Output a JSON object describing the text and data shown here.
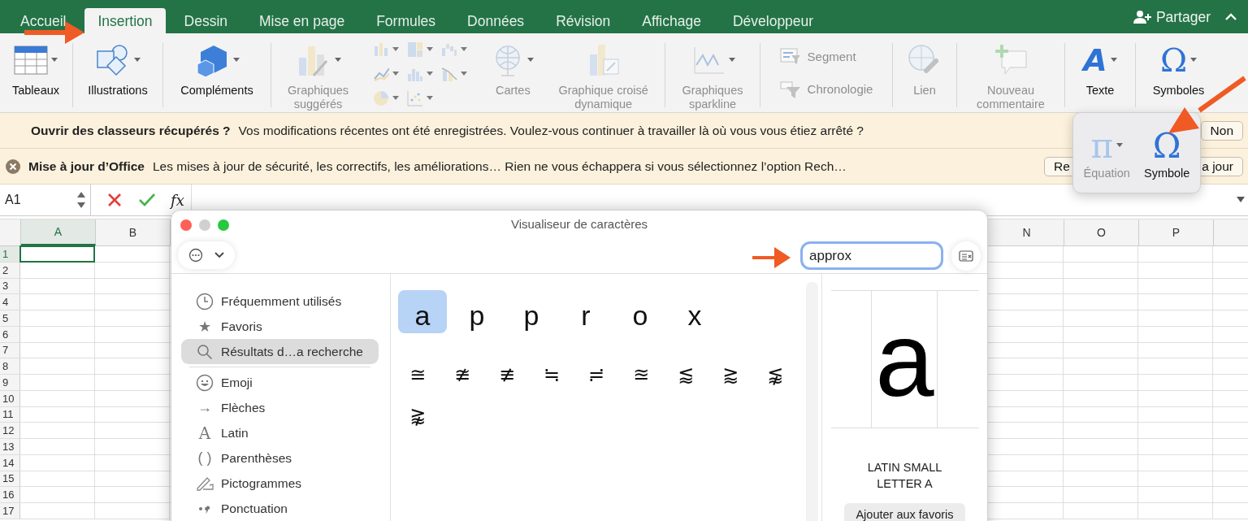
{
  "tabs": [
    {
      "label": "Accueil",
      "selected": false
    },
    {
      "label": "Insertion",
      "selected": true
    },
    {
      "label": "Dessin",
      "selected": false
    },
    {
      "label": "Mise en page",
      "selected": false
    },
    {
      "label": "Formules",
      "selected": false
    },
    {
      "label": "Données",
      "selected": false
    },
    {
      "label": "Révision",
      "selected": false
    },
    {
      "label": "Affichage",
      "selected": false
    },
    {
      "label": "Développeur",
      "selected": false
    }
  ],
  "share_button": {
    "label": "Partager"
  },
  "ribbon": {
    "groups": [
      {
        "items": [
          {
            "kind": "large",
            "label": "Tableaux",
            "dropdown": true,
            "disabled": false
          }
        ]
      },
      {
        "items": [
          {
            "kind": "large",
            "label": "Illustrations",
            "dropdown": true,
            "disabled": false
          }
        ]
      },
      {
        "items": [
          {
            "kind": "large",
            "label": "Compléments",
            "dropdown": true,
            "disabled": false
          }
        ]
      },
      {
        "items": [
          {
            "kind": "large",
            "label": "Graphiques\nsuggérés",
            "dropdown": true,
            "disabled": true
          },
          {
            "kind": "chart_grid",
            "disabled": true
          },
          {
            "kind": "large",
            "label": "Cartes",
            "dropdown": true,
            "disabled": true
          },
          {
            "kind": "large",
            "label": "Graphique croisé\ndynamique",
            "dropdown": false,
            "disabled": true
          }
        ]
      },
      {
        "items": [
          {
            "kind": "large",
            "label": "Graphiques\nsparkline",
            "dropdown": true,
            "disabled": true
          }
        ]
      },
      {
        "items": [
          {
            "kind": "small_list",
            "entries": [
              {
                "label": "Segment",
                "disabled": true
              },
              {
                "label": "Chronologie",
                "disabled": true
              }
            ]
          }
        ]
      },
      {
        "items": [
          {
            "kind": "large",
            "label": "Lien",
            "dropdown": false,
            "disabled": true
          }
        ]
      },
      {
        "items": [
          {
            "kind": "large",
            "label": "Nouveau\ncommentaire",
            "dropdown": false,
            "disabled": true
          }
        ]
      },
      {
        "items": [
          {
            "kind": "large",
            "label": "Texte",
            "glyph": "A",
            "dropdown": true,
            "disabled": false
          }
        ]
      },
      {
        "items": [
          {
            "kind": "large",
            "label": "Symboles",
            "glyph": "Ω",
            "dropdown": true,
            "disabled": false
          }
        ]
      }
    ]
  },
  "symbols_popup": {
    "items": [
      {
        "glyph": "π",
        "label": "Équation",
        "dropdown": true,
        "disabled": true
      },
      {
        "glyph": "Ω",
        "label": "Symbole",
        "dropdown": false,
        "disabled": false
      }
    ]
  },
  "message_bars": [
    {
      "closable": false,
      "title": "Ouvrir des classeurs récupérés ?",
      "message": "Vos modifications récentes ont été enregistrées. Voulez-vous continuer à travailler là où vous vous étiez arrêté ?",
      "button_end": "Non"
    },
    {
      "closable": true,
      "title": "Mise à jour d’Office",
      "message": "Les mises à jour de sécurité, les correctifs, les améliorations… Rien ne vous échappera si vous sélectionnez l’option Rech…",
      "button_start": "Re",
      "button_end": "a jour"
    }
  ],
  "formula_bar": {
    "name_box": "A1",
    "function_label": "fx"
  },
  "sheet": {
    "columns": [
      {
        "label": "A",
        "selected": true
      },
      {
        "label": "B",
        "selected": false
      },
      {
        "label": "N",
        "selected": false
      },
      {
        "label": "O",
        "selected": false
      },
      {
        "label": "P",
        "selected": false
      }
    ],
    "rows": [
      {
        "label": "1",
        "selected": true
      },
      {
        "label": "2",
        "selected": false
      },
      {
        "label": "3",
        "selected": false
      },
      {
        "label": "4",
        "selected": false
      },
      {
        "label": "5",
        "selected": false
      },
      {
        "label": "6",
        "selected": false
      },
      {
        "label": "7",
        "selected": false
      },
      {
        "label": "8",
        "selected": false
      },
      {
        "label": "9",
        "selected": false
      },
      {
        "label": "10",
        "selected": false
      },
      {
        "label": "11",
        "selected": false
      },
      {
        "label": "12",
        "selected": false
      },
      {
        "label": "13",
        "selected": false
      },
      {
        "label": "14",
        "selected": false
      },
      {
        "label": "15",
        "selected": false
      },
      {
        "label": "16",
        "selected": false
      },
      {
        "label": "17",
        "selected": false
      }
    ]
  },
  "character_viewer": {
    "title": "Visualiseur de caractères",
    "search": {
      "value": "approx"
    },
    "categories": [
      {
        "label": "Fréquemment utilisés",
        "selected": false
      },
      {
        "label": "Favoris",
        "glyph": "★",
        "selected": false
      },
      {
        "label": "Résultats d…a recherche",
        "selected": true
      },
      {
        "label": "Emoji",
        "selected": false
      },
      {
        "label": "Flèches",
        "glyph": "→",
        "selected": false
      },
      {
        "label": "Latin",
        "glyph": "A",
        "selected": false
      },
      {
        "label": "Parenthèses",
        "glyph": "( )",
        "selected": false
      },
      {
        "label": "Pictogrammes",
        "selected": false
      },
      {
        "label": "Ponctuation",
        "selected": false
      }
    ],
    "letters": [
      {
        "char": "a",
        "selected": true
      },
      {
        "char": "p",
        "selected": false
      },
      {
        "char": "p",
        "selected": false
      },
      {
        "char": "r",
        "selected": false
      },
      {
        "char": "o",
        "selected": false
      },
      {
        "char": "x",
        "selected": false
      }
    ],
    "symbols": [
      {
        "char": "≅",
        "selected": false
      },
      {
        "char": "≇",
        "selected": false
      },
      {
        "char": "≢",
        "selected": false
      },
      {
        "char": "≒",
        "selected": false
      },
      {
        "char": "≓",
        "selected": false
      },
      {
        "char": "≊",
        "selected": false
      },
      {
        "char": "⪅",
        "selected": false
      },
      {
        "char": "⪆",
        "selected": false
      },
      {
        "char": "⪉",
        "selected": false
      },
      {
        "char": "⪊",
        "selected": false
      }
    ],
    "preview": {
      "char": "a",
      "name": "LATIN SMALL\nLETTER A",
      "button": "Ajouter aux favoris"
    }
  }
}
